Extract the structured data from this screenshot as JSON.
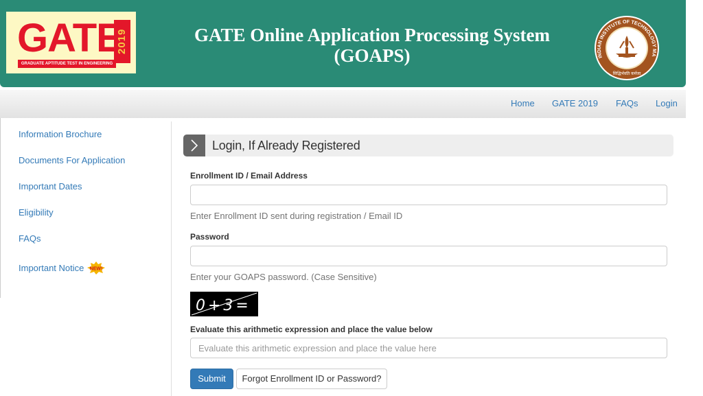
{
  "header": {
    "logo": {
      "word": "GATE",
      "year": "2019",
      "tagline": "GRADUATE APTITUDE TEST IN ENGINEERING"
    },
    "title_line1": "GATE Online Application Processing System",
    "title_line2": "(GOAPS)",
    "seal": {
      "ring_text": "INDIAN INSTITUTE OF TECHNOLOGY MADRAS",
      "motto": "सिद्धिर्भवति कर्मजा"
    }
  },
  "nav": {
    "items": [
      "Home",
      "GATE 2019",
      "FAQs",
      "Login"
    ]
  },
  "sidebar": {
    "items": [
      "Information Brochure",
      "Documents For Application",
      "Important Dates",
      "Eligibility",
      "FAQs",
      "Important Notice"
    ],
    "new_badge": "NEW!"
  },
  "login": {
    "heading": "Login, If Already Registered",
    "enrollment_label": "Enrollment ID / Email Address",
    "enrollment_value": "",
    "enrollment_help": "Enter Enrollment ID sent during registration / Email ID",
    "password_label": "Password",
    "password_value": "",
    "password_help": "Enter your GOAPS password. (Case Sensitive)",
    "captcha_text": "0+3=",
    "captcha_label": "Evaluate this arithmetic expression and place the value below",
    "captcha_placeholder": "Evaluate this arithmetic expression and place the value here",
    "submit_label": "Submit",
    "forgot_label": "Forgot Enrollment ID or Password?"
  },
  "colors": {
    "header_bg": "#2a8b76",
    "logo_red": "#e3172a",
    "link_blue": "#337ab7",
    "primary_button": "#337ab7",
    "seal_brown": "#a3541f"
  }
}
